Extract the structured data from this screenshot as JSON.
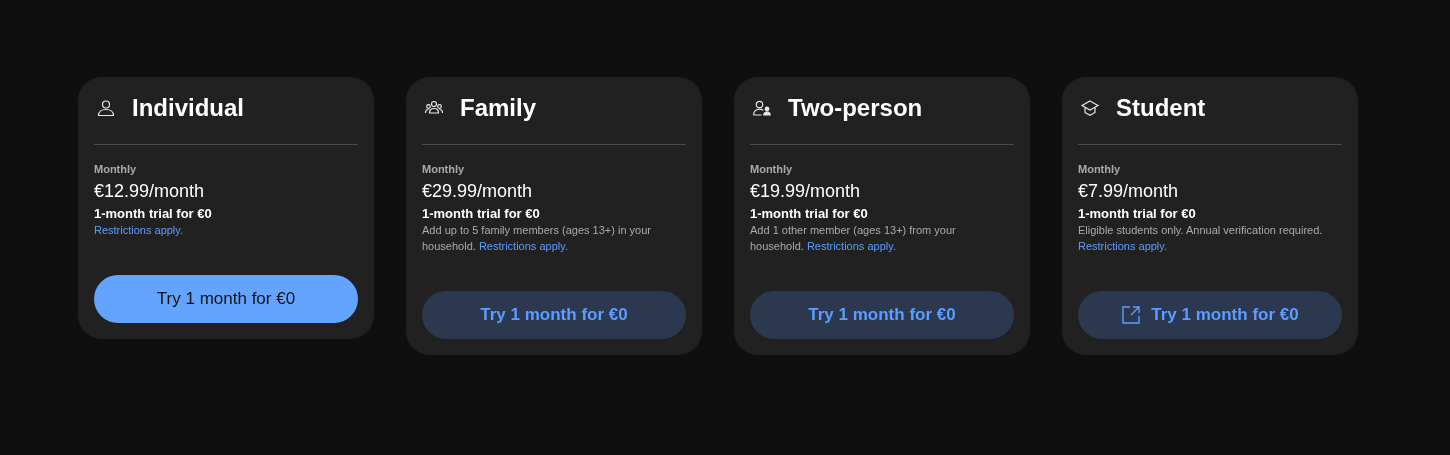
{
  "plans": [
    {
      "kind": "individual",
      "title": "Individual",
      "billing": "Monthly",
      "price": "€12.99/month",
      "trial": "1-month trial for €0",
      "link": "Restrictions apply.",
      "button": {
        "label": "Try 1 month for €0",
        "kind": "filled",
        "external": false
      }
    },
    {
      "kind": "family",
      "title": "Family",
      "billing": "Monthly",
      "price": "€29.99/month",
      "trial": "1-month trial for €0",
      "description": "Add up to 5 family members (ages 13+) in your household.",
      "link": "Restrictions apply.",
      "button": {
        "label": "Try 1 month for €0",
        "kind": "tonal",
        "external": false
      }
    },
    {
      "kind": "two-person",
      "title": "Two-person",
      "billing": "Monthly",
      "price": "€19.99/month",
      "trial": "1-month trial for €0",
      "description": "Add 1 other member (ages 13+) from your household.",
      "link": "Restrictions apply.",
      "button": {
        "label": "Try 1 month for €0",
        "kind": "tonal",
        "external": false
      }
    },
    {
      "kind": "student",
      "title": "Student",
      "billing": "Monthly",
      "price": "€7.99/month",
      "trial": "1-month trial for €0",
      "description": "Eligible students only. Annual verification required.",
      "link": "Restrictions apply.",
      "button": {
        "label": "Try 1 month for €0",
        "kind": "tonal",
        "external": true
      }
    }
  ]
}
